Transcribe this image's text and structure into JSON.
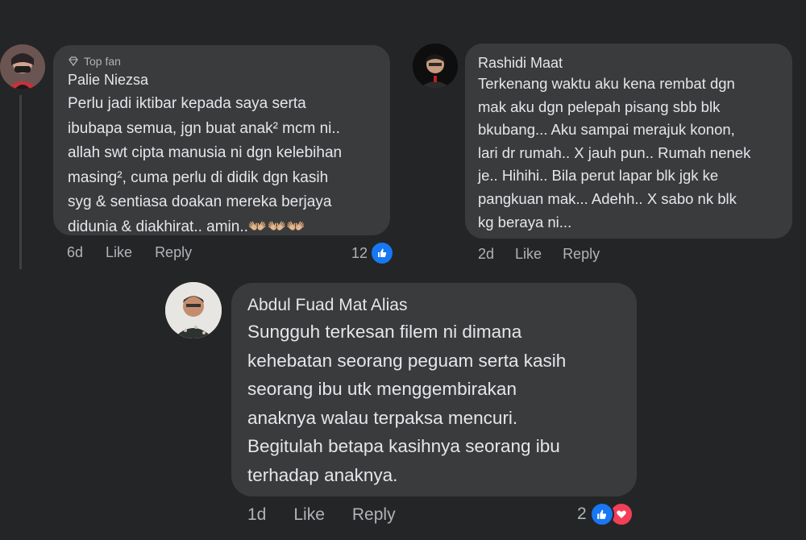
{
  "comments": [
    {
      "badge": "Top fan",
      "name": "Palie Niezsa",
      "lines": [
        "Perlu jadi iktibar kepada saya serta",
        "ibubapa semua, jgn buat anak² mcm ni..",
        "allah swt cipta manusia ni dgn kelebihan",
        "masing², cuma perlu di didik dgn kasih",
        "syg & sentiasa doakan mereka berjaya",
        "didunia & diakhirat.. amin..👐🏼👐🏼👐🏼"
      ],
      "time": "6d",
      "like": "Like",
      "reply": "Reply",
      "reaction_count": "12",
      "reaction_icons": [
        "like-icon"
      ]
    },
    {
      "name": "Rashidi Maat",
      "lines": [
        "Terkenang waktu aku kena rembat dgn",
        "mak aku dgn pelepah pisang sbb blk",
        "bkubang... Aku sampai merajuk konon,",
        "lari dr rumah.. X jauh pun.. Rumah nenek",
        "je.. Hihihi.. Bila perut lapar blk jgk ke",
        "pangkuan mak... Adehh.. X sabo nk blk",
        "kg beraya ni..."
      ],
      "time": "2d",
      "like": "Like",
      "reply": "Reply"
    },
    {
      "name": "Abdul Fuad Mat Alias",
      "lines": [
        "Sungguh terkesan filem ni dimana",
        "kehebatan seorang peguam serta kasih",
        "seorang ibu utk menggembirakan",
        "anaknya walau terpaksa mencuri.",
        "Begitulah betapa kasihnya seorang ibu",
        "terhadap anaknya."
      ],
      "time": "1d",
      "like": "Like",
      "reply": "Reply",
      "reaction_count": "2",
      "reaction_icons": [
        "like-icon",
        "love-icon"
      ]
    }
  ],
  "colors": {
    "background": "#242526",
    "bubble": "#3a3b3c",
    "text": "#e4e6eb",
    "secondary": "#b0b3b8",
    "like_blue": "#1877f2",
    "love_red": "#f33e58"
  }
}
